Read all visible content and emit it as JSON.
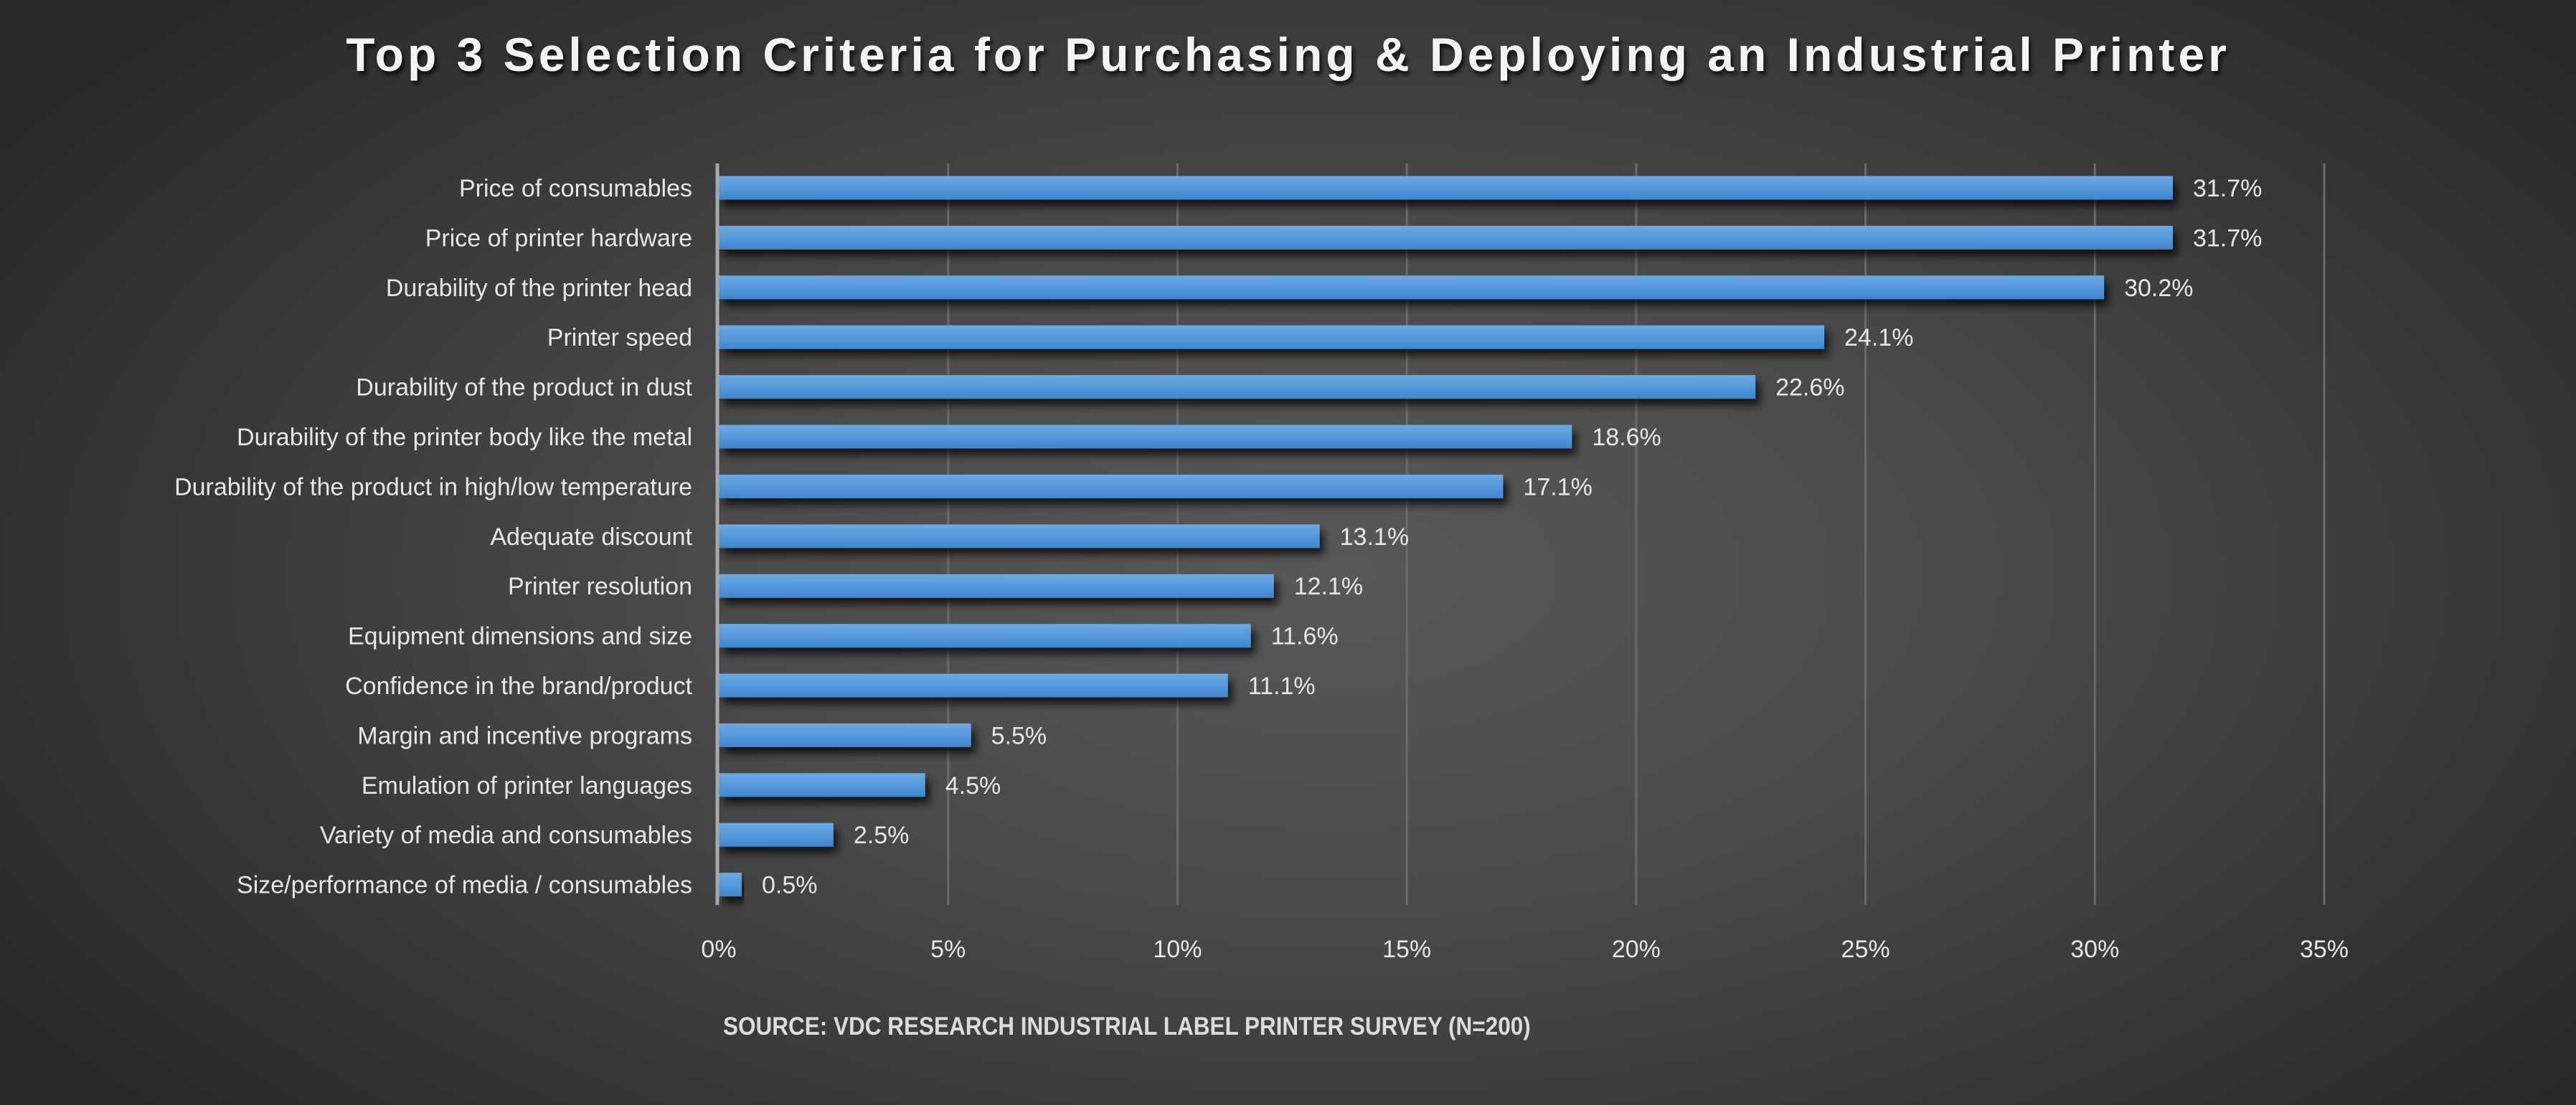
{
  "chart_data": {
    "type": "bar",
    "orientation": "horizontal",
    "title": "Top 3 Selection Criteria for Purchasing & Deploying an Industrial Printer",
    "source": "SOURCE: VDC RESEARCH INDUSTRIAL LABEL PRINTER SURVEY (N=200)",
    "xlabel": "",
    "ylabel": "",
    "xlim": [
      0,
      35
    ],
    "x_ticks": [
      0,
      5,
      10,
      15,
      20,
      25,
      30,
      35
    ],
    "x_tick_labels": [
      "0%",
      "5%",
      "10%",
      "15%",
      "20%",
      "25%",
      "30%",
      "35%"
    ],
    "grid": "vertical",
    "legend": "none",
    "bar_color": "#5b9bd5",
    "categories": [
      "Price of consumables",
      "Price of printer hardware",
      "Durability of the printer head",
      "Printer speed",
      "Durability of the product in dust",
      "Durability of the printer body like the metal",
      "Durability of the product in high/low temperature",
      "Adequate discount",
      "Printer resolution",
      "Equipment dimensions and size",
      "Confidence in the brand/product",
      "Margin and incentive programs",
      "Emulation of  printer languages",
      "Variety of media and consumables",
      "Size/performance of  media / consumables"
    ],
    "values": [
      31.7,
      31.7,
      30.2,
      24.1,
      22.6,
      18.6,
      17.1,
      13.1,
      12.1,
      11.6,
      11.1,
      5.5,
      4.5,
      2.5,
      0.5
    ],
    "value_labels": [
      "31.7%",
      "31.7%",
      "30.2%",
      "24.1%",
      "22.6%",
      "18.6%",
      "17.1%",
      "13.1%",
      "12.1%",
      "11.6%",
      "11.1%",
      "5.5%",
      "4.5%",
      "2.5%",
      "0.5%"
    ]
  }
}
